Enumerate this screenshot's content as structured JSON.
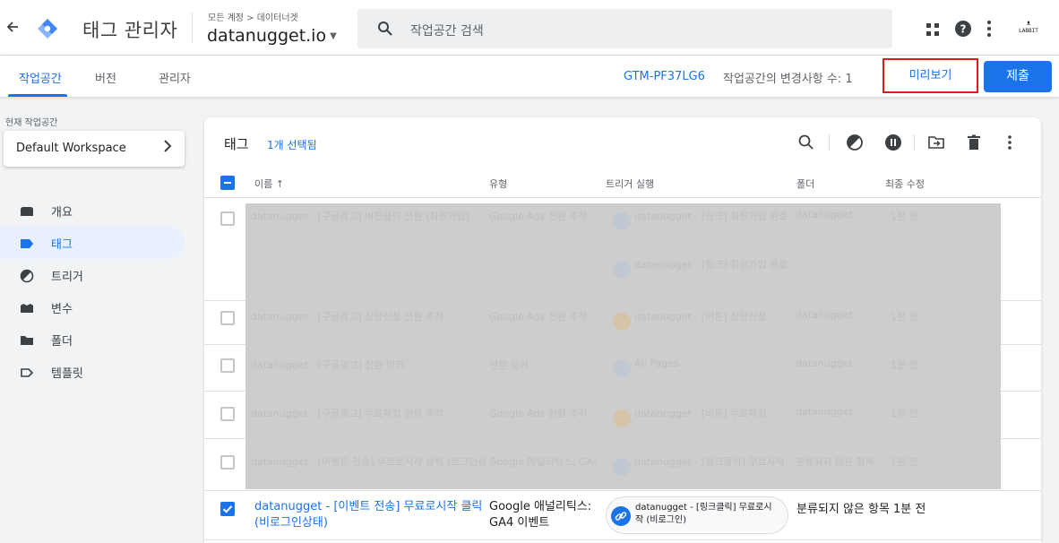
{
  "header": {
    "back_icon": "arrow-back-icon",
    "app_title": "태그 관리자",
    "breadcrumb": "모든 계정 > 데이터너겟",
    "container": "datanugget.io",
    "search_placeholder": "작업공간 검색",
    "icons": [
      "apps-icon",
      "help-icon",
      "more-vert-icon"
    ],
    "account_logo": "LABBIT"
  },
  "nav": {
    "tabs": [
      {
        "label": "작업공간",
        "active": true
      },
      {
        "label": "버전",
        "active": false
      },
      {
        "label": "관리자",
        "active": false
      }
    ],
    "container_id": "GTM-PF37LG6",
    "changes": "작업공간의 변경사항 수: 1",
    "preview_label": "미리보기",
    "submit_label": "제출"
  },
  "sidebar": {
    "workspace_label": "현재 작업공간",
    "workspace_name": "Default Workspace",
    "items": [
      {
        "label": "개요",
        "icon": "overview-icon",
        "active": false
      },
      {
        "label": "태그",
        "icon": "tag-icon",
        "active": true
      },
      {
        "label": "트리거",
        "icon": "trigger-icon",
        "active": false
      },
      {
        "label": "변수",
        "icon": "variables-icon",
        "active": false
      },
      {
        "label": "폴더",
        "icon": "folder-icon",
        "active": false
      },
      {
        "label": "템플릿",
        "icon": "template-icon",
        "active": false
      }
    ]
  },
  "tags": {
    "title": "태그",
    "selected": "1개 선택됨",
    "toolbar_icons": [
      "search-icon",
      "trigger-icon",
      "pause-icon",
      "move-to-folder-icon",
      "delete-icon",
      "more-vert-icon"
    ],
    "columns": [
      "이름 ↑",
      "유형",
      "트리거 실행",
      "폴더",
      "최종 수정"
    ],
    "ghost_rows": [
      {
        "name": "datanugget - [구글광고] 버튼클릭 전환 (회원가입)",
        "type": "Google Ads 전환 추적",
        "trigger": "datanugget - [링크] 회원가입 완료",
        "folder": "datanugget",
        "modified": "1분 전"
      },
      {
        "name": "datanugget - [구글광고] 상담신청 전환 추적",
        "type": "Google Ads 전환 추적",
        "trigger": "datanugget - [버튼] 상담신청",
        "folder": "datanugget",
        "modified": "1분 전"
      },
      {
        "name": "datanugget - [구글광고] 전환 링커",
        "type": "전환 링커",
        "trigger": "All Pages",
        "folder": "datanugget",
        "modified": "1분 전"
      },
      {
        "name": "datanugget - [구글광고] 무료체험 전환 추적",
        "type": "Google Ads 전환 추적",
        "trigger": "datanugget - [버튼] 무료체험",
        "folder": "datanugget",
        "modified": "1분 전"
      },
      {
        "name": "datanugget - [이벤트 전송] 무료로시작 클릭 (로그인상태)",
        "type": "Google 애널리틱스: GA4 이벤트",
        "trigger": "datanugget - [링크클릭] 무료시작 (로그인)",
        "folder": "분류되지 않은 항목",
        "modified": "1분 전"
      }
    ],
    "selected_row": {
      "name": "datanugget - [이벤트 전송] 무료로시작 클릭 (비로그인상태)",
      "type": "Google 애널리틱스: GA4 이벤트",
      "trigger": "datanugget - [링크클릭] 무료로시작 (비로그인)",
      "folder": "분류되지 않은 항목",
      "modified": "1분 전"
    }
  }
}
